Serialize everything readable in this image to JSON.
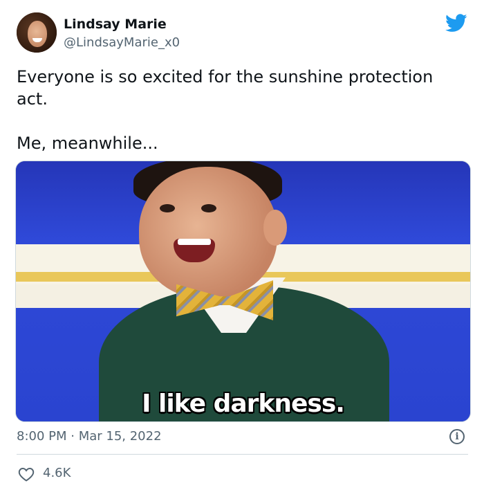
{
  "tweet": {
    "author": {
      "name": "Lindsay Marie",
      "handle": "@LindsayMarie_x0",
      "avatar_icon": "avatar"
    },
    "platform_icon": "twitter-bird-icon",
    "brand_color": "#1d9bf0",
    "text_lines": [
      "Everyone is so excited for the sunshine protection act.",
      "Me, meanwhile..."
    ],
    "media": {
      "caption": "I like darkness."
    },
    "timestamp": "8:00 PM · Mar 15, 2022",
    "info_icon": "info-icon",
    "likes": {
      "icon": "heart-icon",
      "count": "4.6K"
    }
  }
}
